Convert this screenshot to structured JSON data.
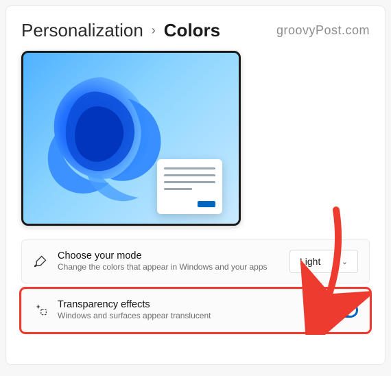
{
  "breadcrumb": {
    "parent": "Personalization",
    "current": "Colors"
  },
  "watermark": "groovyPost.com",
  "settings": {
    "mode": {
      "title": "Choose your mode",
      "subtitle": "Change the colors that appear in Windows and your apps",
      "value": "Light"
    },
    "transparency": {
      "title": "Transparency effects",
      "subtitle": "Windows and surfaces appear translucent",
      "state_label": "On",
      "enabled": true
    }
  },
  "colors": {
    "accent": "#0067c0",
    "highlight": "#ee3b2f"
  }
}
